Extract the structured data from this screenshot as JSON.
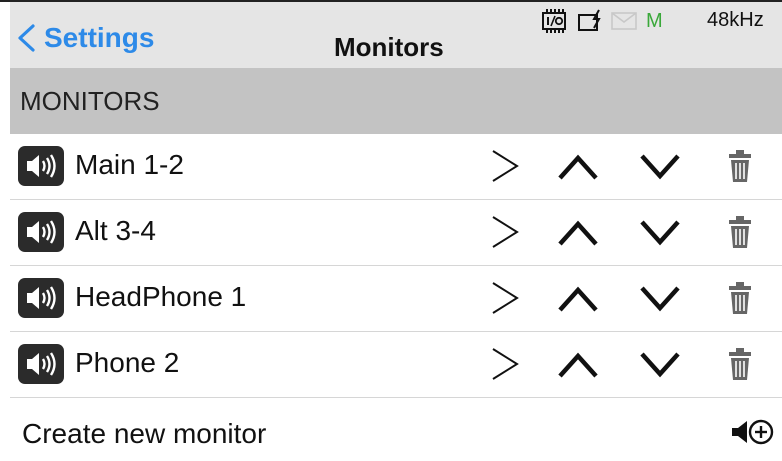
{
  "header": {
    "back_label": "Settings",
    "title": "Monitors",
    "status": {
      "icons": [
        "io-chip-icon",
        "battery-charge-icon",
        "mail-icon"
      ],
      "indicator": "M",
      "indicator_color": "#3aa83a",
      "sample_rate": "48kHz"
    }
  },
  "section": {
    "label": "MONITORS"
  },
  "monitors": [
    {
      "name": "Main 1-2"
    },
    {
      "name": "Alt 3-4"
    },
    {
      "name": "HeadPhone 1"
    },
    {
      "name": "Phone 2"
    }
  ],
  "create": {
    "label": "Create new monitor"
  },
  "colors": {
    "accent": "#2d8ae8",
    "header_bg": "#e5e5e5",
    "section_bg": "#c3c3c3",
    "icon_bg": "#2b2b2b",
    "trash": "#666666"
  }
}
